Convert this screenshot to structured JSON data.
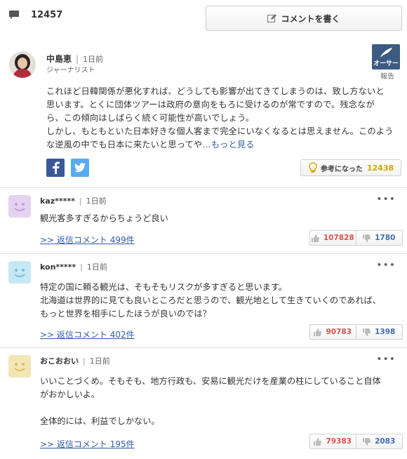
{
  "header": {
    "comment_count": "12457",
    "write_button_label": "コメントを書く"
  },
  "expert": {
    "name": "中島恵",
    "time": "1日前",
    "role": "ジャーナリスト",
    "badge_label": "オーサー",
    "report_label": "報告",
    "body_lines": [
      "これほど日韓関係が悪化すれば、どうしても影響が出てきてしまうのは、致し方ないと",
      "思います。とくに団体ツアーは政府の意向をもろに受けるのが常ですので。残念なが",
      "ら、この傾向はしばらく続く可能性が高いでしょう。",
      "しかし、もともといた日本好きな個人客まで完全にいなくなるとは思えません。このよう",
      "な逆風の中でも日本に来たいと思ってや"
    ],
    "more_label": "…もっと見る",
    "helpful_label": "参考になった",
    "helpful_count": "12438"
  },
  "comments": [
    {
      "user": "kaz*****",
      "time": "1日前",
      "avatar_color": "#e6d2f0",
      "face_color": "#c79be0",
      "body": [
        "観光客多すぎるからちょうど良い"
      ],
      "reply_label": ">> 返信コメント 499件",
      "likes": "107828",
      "dislikes": "1780"
    },
    {
      "user": "kon*****",
      "time": "1日前",
      "avatar_color": "#c6e8f5",
      "face_color": "#6fc0e0",
      "body": [
        "特定の国に頼る観光は、そもそもリスクが多すぎると思います。",
        "北海道は世界的に見ても良いところだと思うので、観光地として生きていくのであれば、",
        "もっと世界を相手にしたほうが良いのでは？"
      ],
      "reply_label": ">> 返信コメント 402件",
      "likes": "90783",
      "dislikes": "1398"
    },
    {
      "user": "おこおおい",
      "time": "1日前",
      "avatar_color": "#f3e6b5",
      "face_color": "#d9bf5e",
      "body": [
        "いいことづくめ。そもそも、地方行政も、安易に観光だけを産業の柱にしていること自体",
        "がおかしいよ。",
        "",
        "全体的には、利益でしかない。"
      ],
      "reply_label": ">> 返信コメント 195件",
      "likes": "79383",
      "dislikes": "2083"
    }
  ],
  "menu_icon": "more-dots-icon",
  "colors": {
    "link": "#2f5ca8",
    "like": "#d9534f",
    "dislike": "#3f6fb5",
    "helpful_count": "#d9a400",
    "facebook": "#3b5998",
    "twitter": "#55acee"
  }
}
